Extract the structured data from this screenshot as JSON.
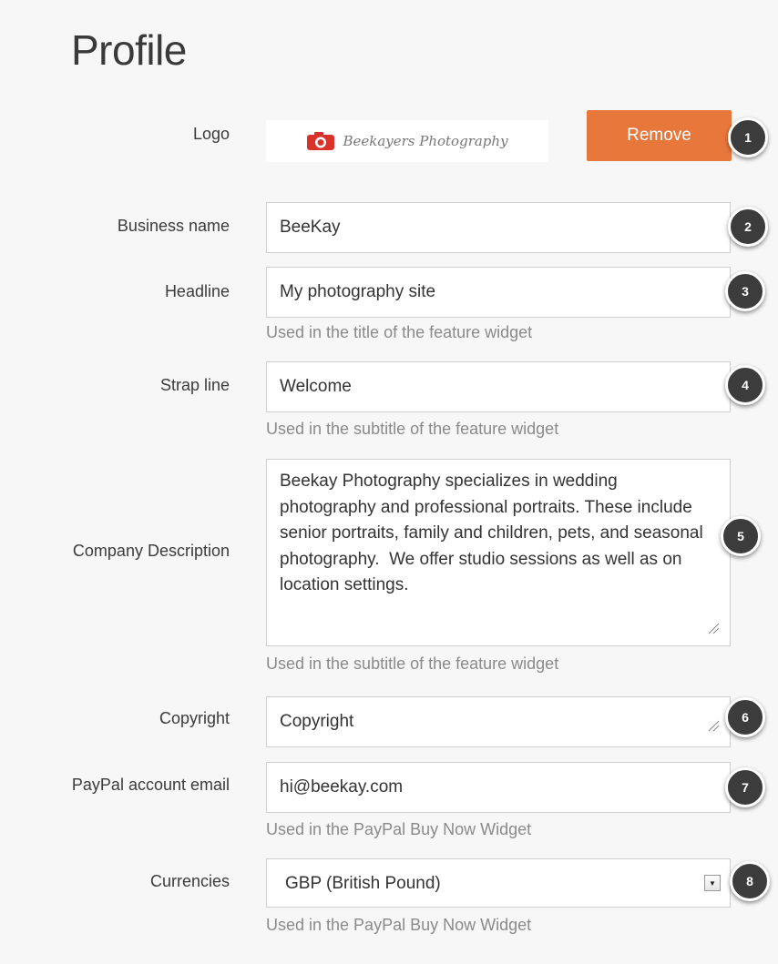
{
  "page": {
    "title": "Profile"
  },
  "logo": {
    "label": "Logo",
    "image_text": "Beekayers Photography",
    "remove_label": "Remove",
    "badge": "1"
  },
  "business_name": {
    "label": "Business name",
    "value": "BeeKay",
    "badge": "2"
  },
  "headline": {
    "label": "Headline",
    "value": "My photography site",
    "help": "Used in the title of the feature widget",
    "badge": "3"
  },
  "strap_line": {
    "label": "Strap line",
    "value": "Welcome",
    "help": "Used in the subtitle of the feature widget",
    "badge": "4"
  },
  "company_description": {
    "label": "Company Description",
    "value": "Beekay Photography specializes in wedding photography and professional portraits. These include senior portraits, family and children, pets, and seasonal photography.  We offer studio sessions as well as on location settings.",
    "help": "Used in the subtitle of the feature widget",
    "badge": "5"
  },
  "copyright": {
    "label": "Copyright",
    "value": "Copyright",
    "badge": "6"
  },
  "paypal_email": {
    "label": "PayPal account email",
    "value": "hi@beekay.com",
    "help": "Used in the PayPal Buy Now Widget",
    "badge": "7"
  },
  "currencies": {
    "label": "Currencies",
    "selected": "GBP (British Pound)",
    "help": "Used in the PayPal Buy Now Widget",
    "badge": "8"
  },
  "colors": {
    "accent": "#e8773c",
    "badge_bg": "#3c3c3c",
    "help_text": "#8a8a8a"
  }
}
